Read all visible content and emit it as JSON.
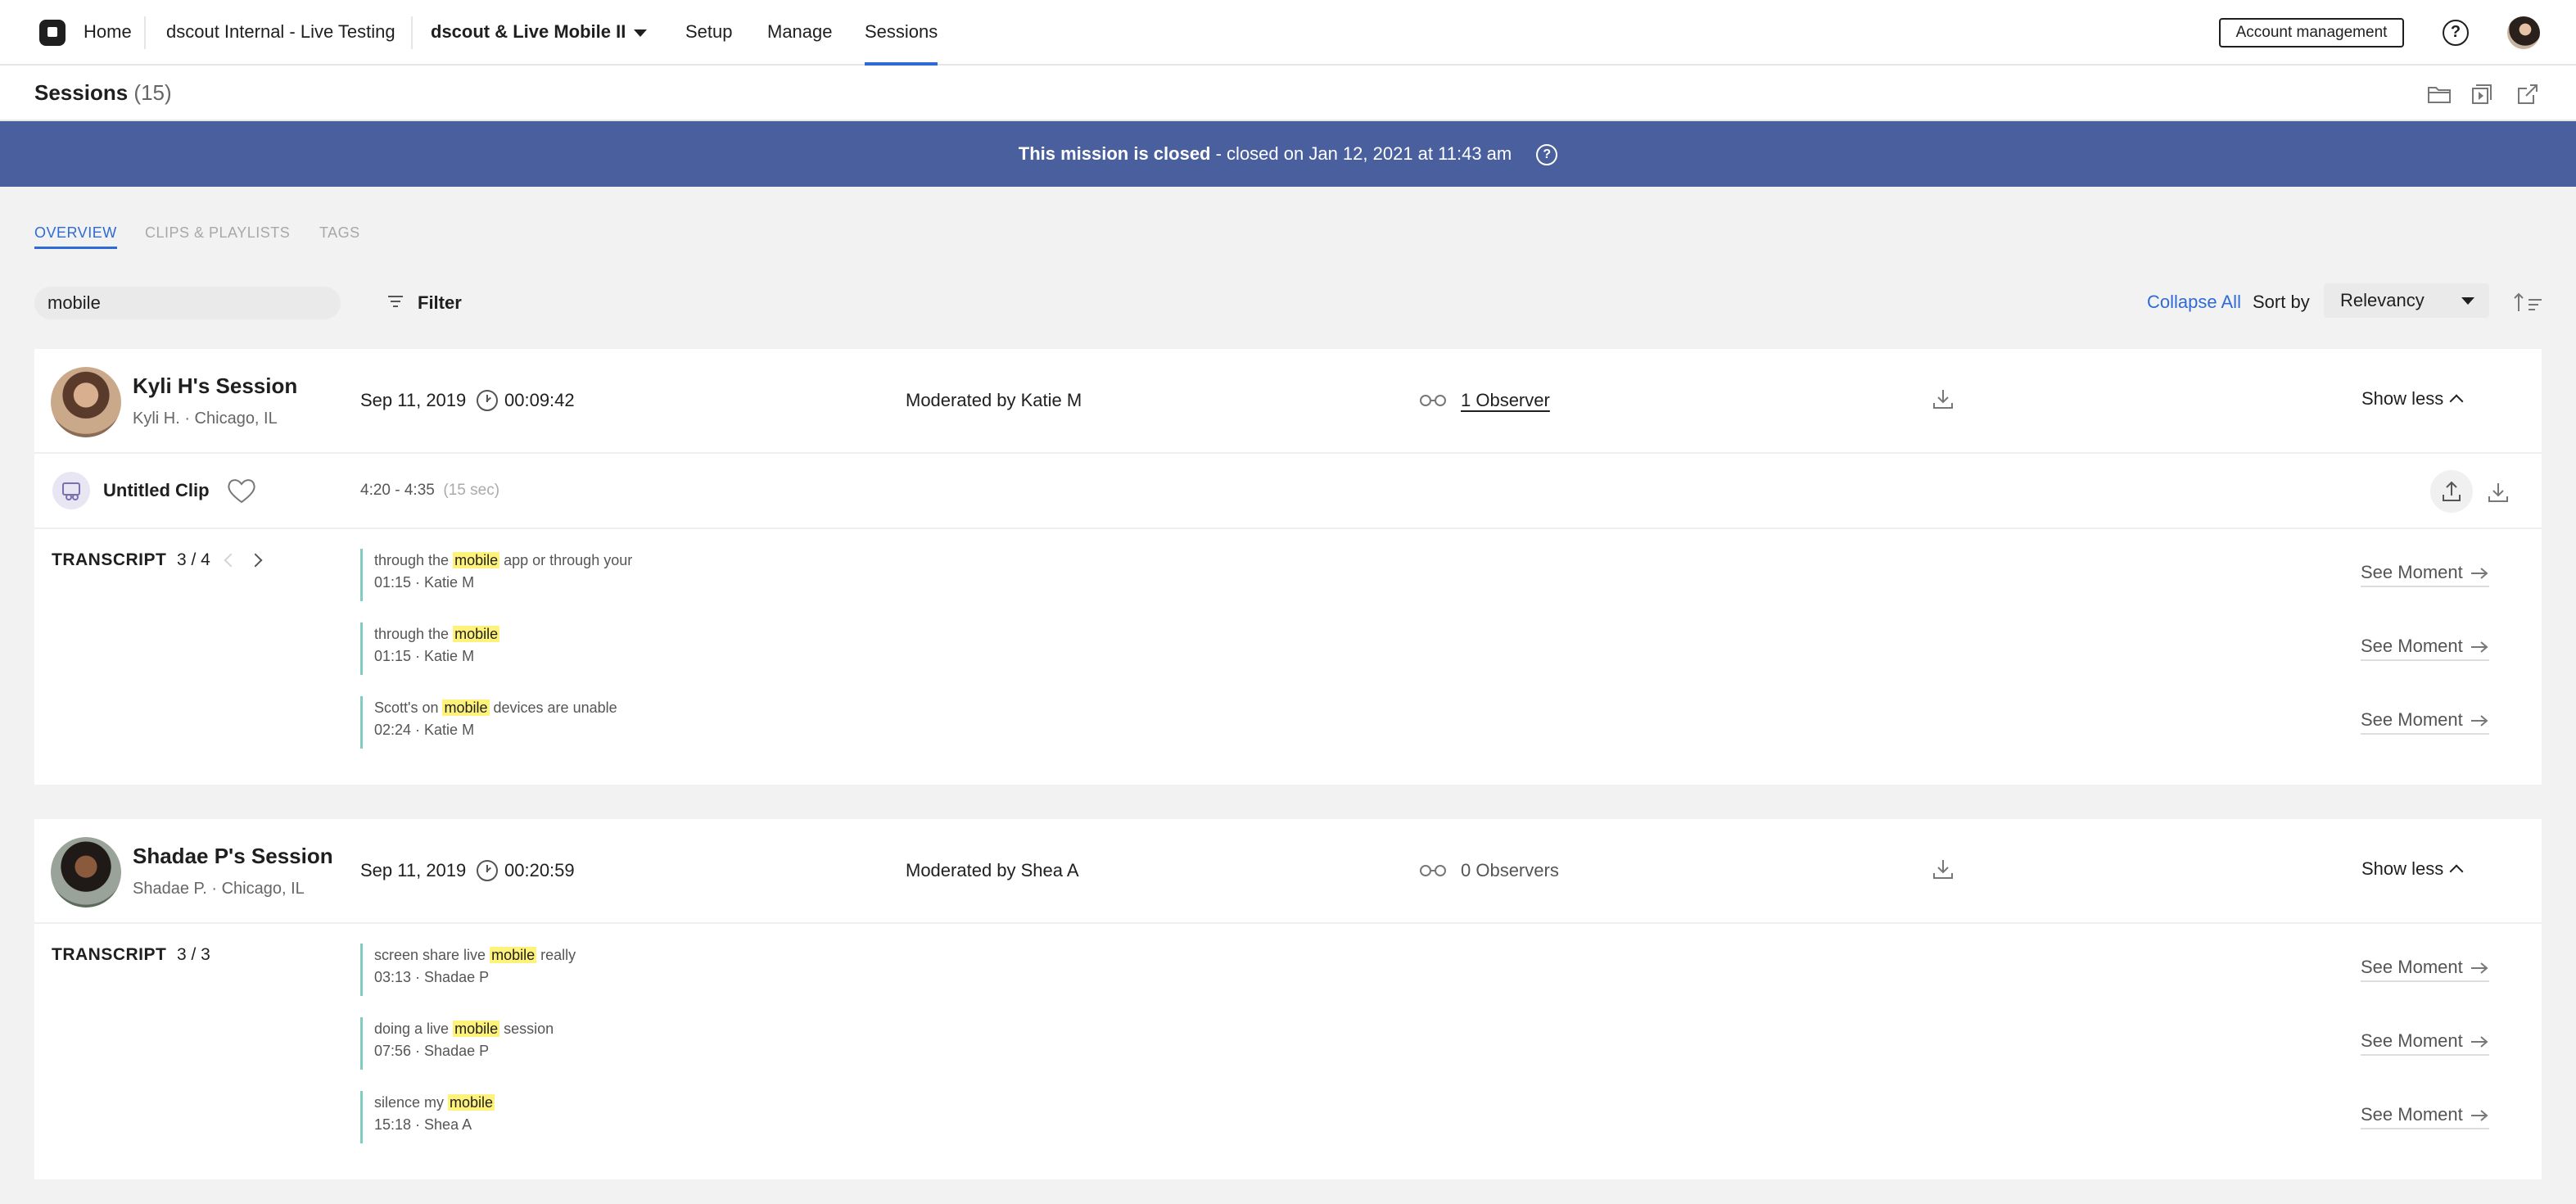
{
  "nav": {
    "home": "Home",
    "workspace": "dscout Internal - Live Testing",
    "mission": "dscout & Live Mobile II",
    "setup": "Setup",
    "manage": "Manage",
    "sessions": "Sessions",
    "account_button": "Account management",
    "help": "?"
  },
  "page": {
    "title": "Sessions",
    "count": "(15)"
  },
  "banner": {
    "bold": "This mission is closed",
    "rest": " - closed on Jan 12, 2021 at 11:43 am",
    "help": "?"
  },
  "tabs": [
    "OVERVIEW",
    "CLIPS & PLAYLISTS",
    "TAGS"
  ],
  "toolbar": {
    "search_value": "mobile",
    "filter_label": "Filter",
    "collapse_all": "Collapse All",
    "sort_by": "Sort by",
    "sort_value": "Relevancy"
  },
  "sessions": [
    {
      "title": "Kyli H's Session",
      "subtitle": "Kyli H. · Chicago, IL",
      "date": "Sep 11, 2019",
      "duration": "00:09:42",
      "moderator": "Moderated by Katie M",
      "observers": "1 Observer",
      "toggle": "Show less",
      "clip": {
        "title": "Untitled Clip",
        "range": "4:20 - 4:35",
        "length": "(15 sec)"
      },
      "transcript_label": "TRANSCRIPT",
      "transcript_count": "3 / 4",
      "moments": [
        {
          "before": "through the ",
          "match": "mobile",
          "after": " app or through your",
          "meta": "01:15 · Katie M",
          "link": "See Moment"
        },
        {
          "before": "through the ",
          "match": "mobile",
          "after": "",
          "meta": "01:15 · Katie M",
          "link": "See Moment"
        },
        {
          "before": "Scott's on ",
          "match": "mobile",
          "after": " devices are unable",
          "meta": "02:24 · Katie M",
          "link": "See Moment"
        }
      ]
    },
    {
      "title": "Shadae P's Session",
      "subtitle": "Shadae P. · Chicago, IL",
      "date": "Sep 11, 2019",
      "duration": "00:20:59",
      "moderator": "Moderated by Shea A",
      "observers": "0 Observers",
      "toggle": "Show less",
      "transcript_label": "TRANSCRIPT",
      "transcript_count": "3 / 3",
      "moments": [
        {
          "before": "screen share live ",
          "match": "mobile",
          "after": " really",
          "meta": "03:13 · Shadae P",
          "link": "See Moment"
        },
        {
          "before": "doing a live ",
          "match": "mobile",
          "after": " session",
          "meta": "07:56 · Shadae P",
          "link": "See Moment"
        },
        {
          "before": "silence my ",
          "match": "mobile",
          "after": "",
          "meta": "15:18 · Shea A",
          "link": "See Moment"
        }
      ]
    }
  ],
  "colors": {
    "banner": "#4a5f9e",
    "accent": "#2e6bd6",
    "highlight": "#fff27a",
    "quote_bar": "#7ecdc0"
  }
}
